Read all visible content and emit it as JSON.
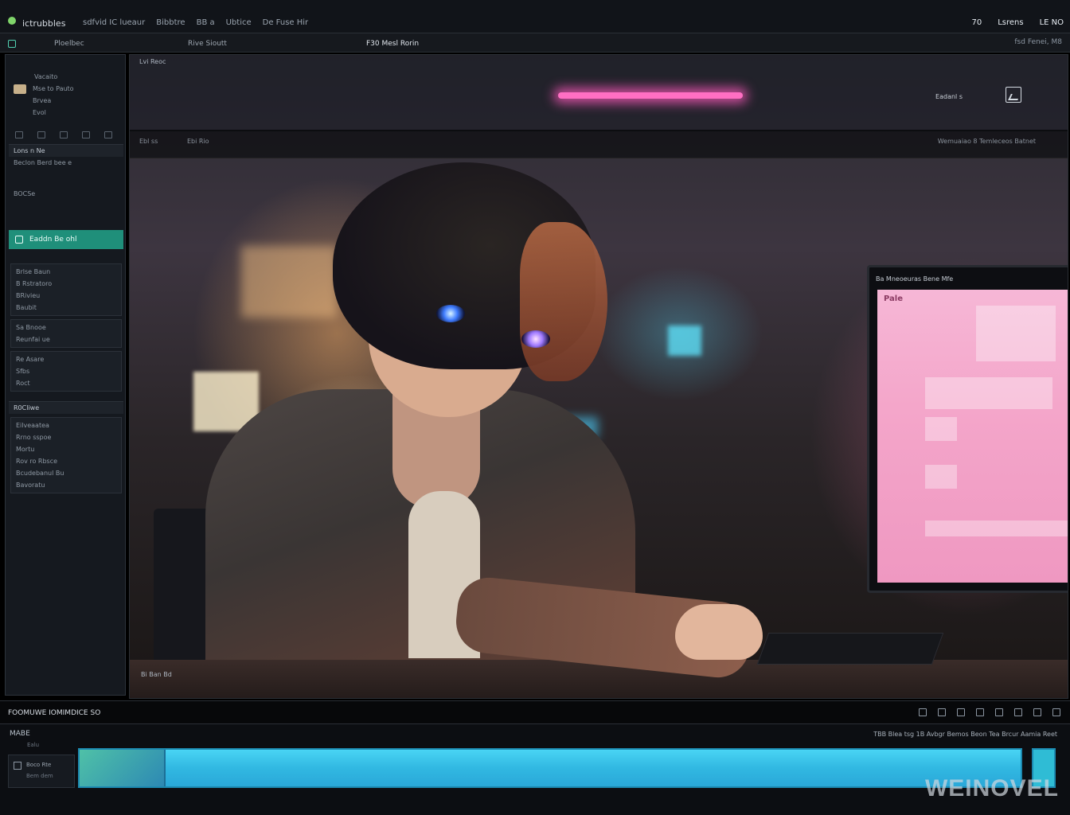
{
  "titlebar": {
    "app_name": "ictrubbles",
    "menu": [
      "sdfvid IC lueaur",
      "Bibbtre",
      "BB a",
      "Ubtice",
      "De Fuse Hir"
    ],
    "right": [
      "70",
      "Lsrens",
      "LE NO"
    ]
  },
  "tabs": {
    "items": [
      "Ploelbec",
      "Rive Sioutt",
      "F30 Mesl Rorin"
    ],
    "right": "fsd Fenei, M8"
  },
  "sidebar": {
    "top_items": [
      "Vacaito",
      "Mse to Pauto",
      "Brvea",
      "Evol"
    ],
    "header1": "Lons n Ne",
    "header1_sub": "Beclon Berd bee e",
    "header2": "BOCSe",
    "active_item": "Eaddn Be ohl",
    "group1": [
      "Brlse Baun",
      "B Rstratoro",
      "BRivieu",
      "Baubit",
      "Sa Bnooe"
    ],
    "group2": [
      "Reunfai ue",
      "Re Asare",
      "Sfbs",
      "Roct"
    ],
    "header3": "R0Cliwe",
    "group3": [
      "Eilveaatea",
      "Rrno sspoe",
      "Mortu",
      "Rov ro Rbsce",
      "Bcudebanul Bu"
    ],
    "footer": "Bavoratu"
  },
  "viewport": {
    "strip_label": "Lvi Reoc",
    "strip_tool": "Eadanl s",
    "toolbar_left": "Ebl ss",
    "toolbar_mid": "Ebi Rio",
    "toolbar_right": "Wemuaiao 8 Temleceos Batnet",
    "monitor_bar": "Ba Mneoeuras Bene Mfe",
    "monitor_title": "Pale",
    "bottom": "Bi Ban Bd"
  },
  "statusbar": {
    "left": "FOOMUWE IOMIMDICE SO"
  },
  "timeline": {
    "label": "MABE",
    "sub": "Ealu",
    "right": "TBB Blea tsg 1B Avbgr Bemos Beon Tea Brcur Aamia Reet",
    "track_name": "Boco Rte",
    "track_sub": "Bem dem"
  },
  "watermark": "WEINOVEL"
}
